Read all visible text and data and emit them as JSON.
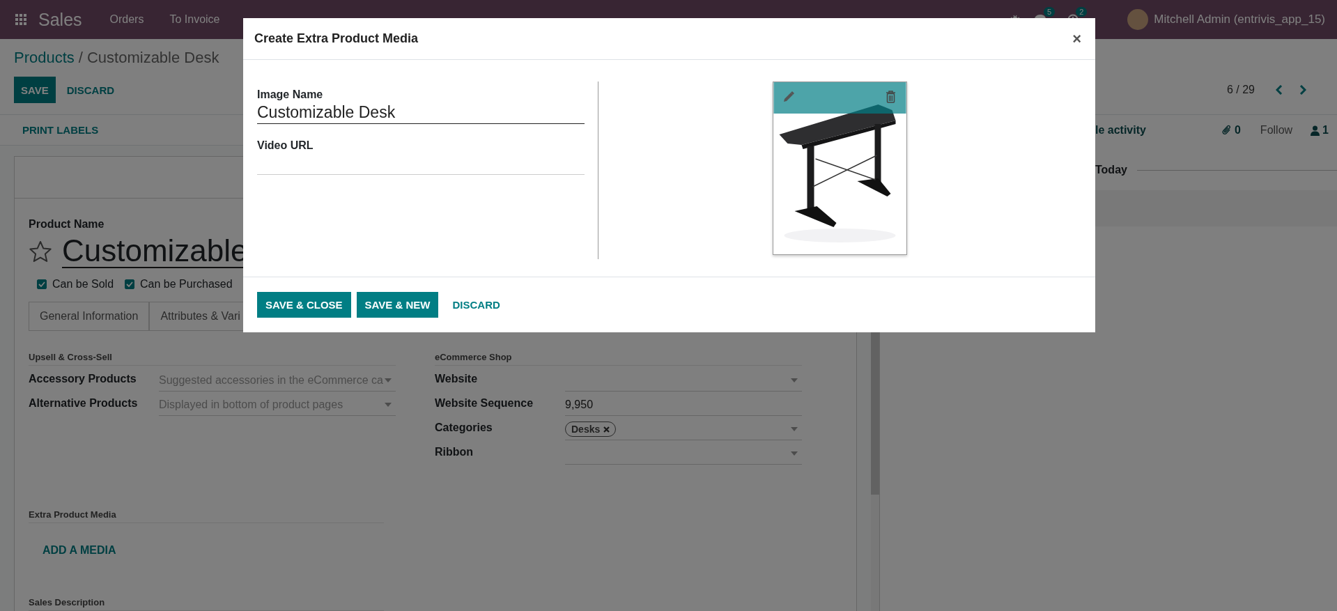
{
  "navbar": {
    "app": "Sales",
    "menu": [
      "Orders",
      "To Invoice"
    ],
    "messages_badge": "5",
    "activities_badge": "2",
    "user": "Mitchell Admin (entrivis_app_15)"
  },
  "breadcrumb": {
    "parent": "Products",
    "separator": "/",
    "current": "Customizable Desk"
  },
  "form_buttons": [
    {
      "label": "SAVE",
      "kind": "primary"
    },
    {
      "label": "DISCARD",
      "kind": "link"
    }
  ],
  "pager": "6 / 29",
  "status_bar": {
    "buttons": [
      "PRINT LABELS"
    ]
  },
  "form": {
    "name_label": "Product Name",
    "name": "Customizable",
    "favorite": false,
    "options": [
      {
        "label": "Can be Sold",
        "checked": true
      },
      {
        "label": "Can be Purchased",
        "checked": true
      }
    ],
    "tabs": [
      {
        "label": "General Information",
        "selected": false
      },
      {
        "label": "Attributes & Vari",
        "selected": false
      }
    ],
    "groups": [
      {
        "title": "Upsell & Cross-Sell",
        "fields": [
          {
            "label": "Accessory Products",
            "kind": "select",
            "placeholder": "Suggested accessories in the eCommerce ca"
          },
          {
            "label": "Alternative Products",
            "kind": "select",
            "placeholder": "Displayed in bottom of product pages"
          }
        ]
      },
      {
        "title": "eCommerce Shop",
        "fields": [
          {
            "label": "Website",
            "kind": "select"
          },
          {
            "label": "Website Sequence",
            "kind": "text",
            "value": "9,950"
          },
          {
            "label": "Categories",
            "kind": "tags",
            "tags": [
              "Desks"
            ]
          },
          {
            "label": "Ribbon",
            "kind": "select"
          }
        ]
      }
    ],
    "extra_media": {
      "title": "Extra Product Media",
      "button": "ADD A MEDIA"
    },
    "sales_description": {
      "title": "Sales Description"
    }
  },
  "chatter": {
    "schedule": "le activity",
    "attachments": "0",
    "follow": "Follow",
    "followers": "1",
    "date_separator": "Today"
  },
  "dialog": {
    "title": "Create Extra Product Media",
    "close": "×",
    "fields": [
      {
        "label": "Image Name",
        "value": "Customizable Desk",
        "focused": true
      },
      {
        "label": "Video URL",
        "focused": false
      }
    ],
    "buttons": [
      {
        "label": "SAVE & CLOSE",
        "kind": "primary"
      },
      {
        "label": "SAVE & NEW",
        "kind": "primary"
      },
      {
        "label": "DISCARD",
        "kind": "link"
      }
    ]
  }
}
